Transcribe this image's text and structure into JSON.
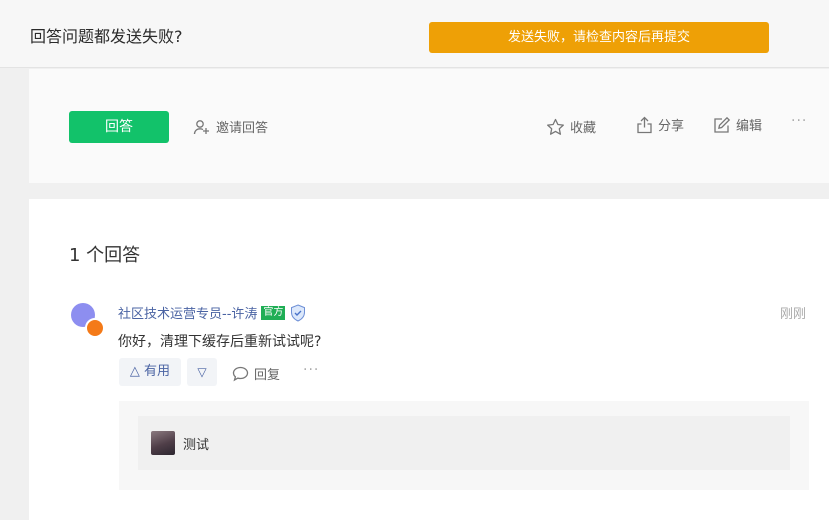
{
  "question": {
    "title": "回答问题都发送失败?"
  },
  "error_toast": "发送失败，请检查内容后再提交",
  "actions": {
    "answer": "回答",
    "invite": "邀请回答",
    "favorite": "收藏",
    "share": "分享",
    "edit": "编辑",
    "more": "···"
  },
  "answers": {
    "count_label": "1 个回答",
    "items": [
      {
        "author": "社区技术运营专员--许涛",
        "badge": "官方",
        "time": "刚刚",
        "content": "你好，清理下缓存后重新试试呢?",
        "vote_up": "△ 有用",
        "vote_down": "▽",
        "reply": "回复",
        "more": "···",
        "comments": [
          {
            "text": "测试"
          }
        ]
      }
    ]
  },
  "colors": {
    "primary_green": "#12c26a",
    "error_orange": "#eea006",
    "link_blue": "#4a63a3"
  },
  "icons": [
    "user-plus-icon",
    "star-icon",
    "share-icon",
    "edit-icon",
    "shield-icon",
    "comment-icon"
  ]
}
